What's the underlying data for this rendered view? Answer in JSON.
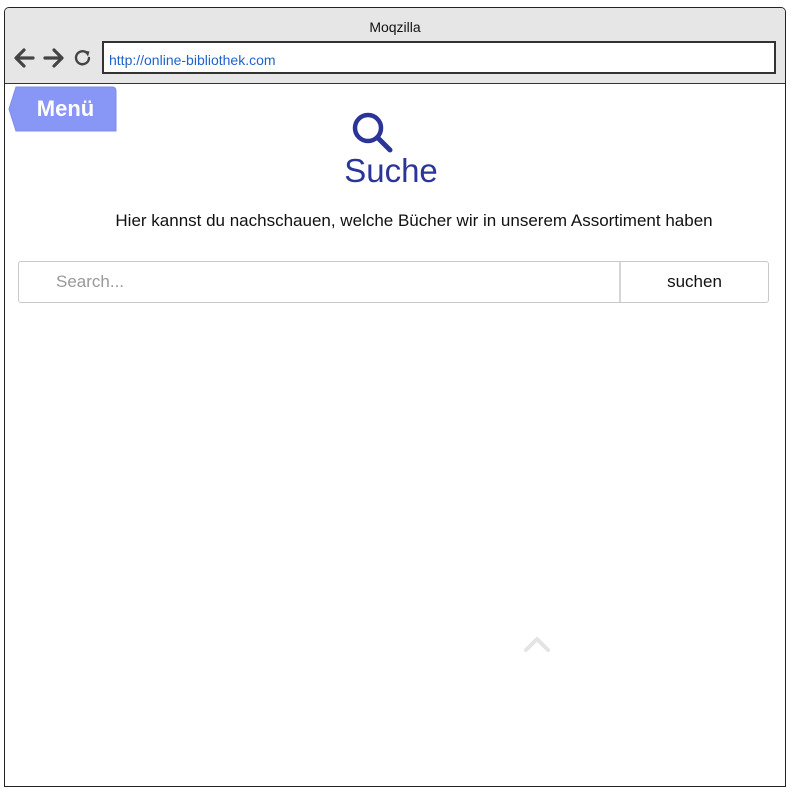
{
  "browser": {
    "title": "Moqzilla",
    "url": "http://online-bibliothek.com",
    "back_icon": "arrow-left-icon",
    "forward_icon": "arrow-right-icon",
    "reload_icon": "reload-icon"
  },
  "menu": {
    "label": "Menü",
    "color": "#8896f5"
  },
  "page": {
    "icon": "search-icon",
    "title": "Suche",
    "subtitle": "Hier kannst du nachschauen, welche Bücher wir in unserem Assortiment haben",
    "accent_color": "#2b3598"
  },
  "search": {
    "placeholder": "Search...",
    "value": "",
    "button_label": "suchen"
  },
  "scroll_top": {
    "icon": "chevron-up-icon"
  }
}
